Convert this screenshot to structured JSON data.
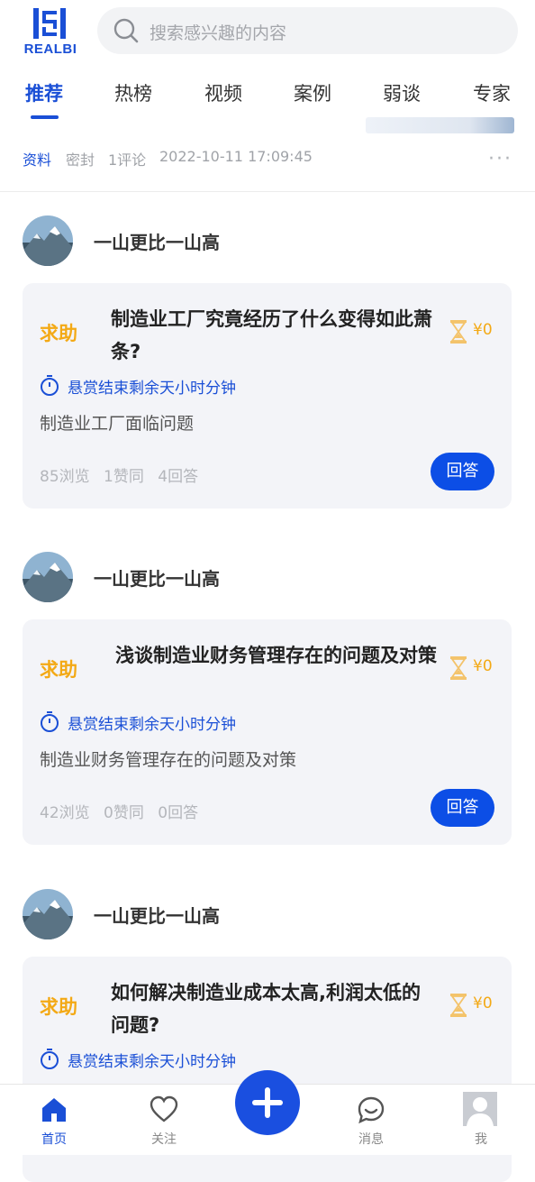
{
  "header": {
    "logo_text": "REALBI",
    "search_placeholder": "搜索感兴趣的内容"
  },
  "tabs": [
    {
      "label": "推荐",
      "active": true
    },
    {
      "label": "热榜",
      "active": false
    },
    {
      "label": "视频",
      "active": false
    },
    {
      "label": "案例",
      "active": false
    },
    {
      "label": "弱谈",
      "active": false
    },
    {
      "label": "专家",
      "active": false
    }
  ],
  "prev_item": {
    "tag": "资料",
    "status": "密封",
    "comments": "1评论",
    "time": "2022-10-11 17:09:45",
    "more": "···"
  },
  "posts": [
    {
      "author": "一山更比一山高",
      "badge": "求助",
      "title": "制造业工厂究竟经历了什么变得如此萧条?",
      "reward": "¥0",
      "timer": "悬赏结束剩余天小时分钟",
      "desc": "制造业工厂面临问题",
      "views": "85浏览",
      "likes": "1赞同",
      "answers": "4回答",
      "answer_btn": "回答"
    },
    {
      "author": "一山更比一山高",
      "badge": "求助",
      "title": "浅谈制造业财务管理存在的问题及对策",
      "reward": "¥0",
      "timer": "悬赏结束剩余天小时分钟",
      "desc": "制造业财务管理存在的问题及对策",
      "views": "42浏览",
      "likes": "0赞同",
      "answers": "0回答",
      "answer_btn": "回答"
    },
    {
      "author": "一山更比一山高",
      "badge": "求助",
      "title": "如何解决制造业成本太高,利润太低的问题?",
      "reward": "¥0",
      "timer": "悬赏结束剩余天小时分钟"
    }
  ],
  "bottom_nav": [
    {
      "label": "首页",
      "icon": "home-icon",
      "active": true
    },
    {
      "label": "关注",
      "icon": "heart-icon",
      "active": false
    },
    {
      "label": "",
      "icon": "plus-icon",
      "active": false
    },
    {
      "label": "消息",
      "icon": "chat-icon",
      "active": false
    },
    {
      "label": "我",
      "icon": "avatar-icon",
      "active": false
    }
  ],
  "colors": {
    "accent": "#1a4fd6",
    "reward": "#f3a915",
    "card_bg": "#f3f4f8",
    "button": "#0c4ee6"
  }
}
